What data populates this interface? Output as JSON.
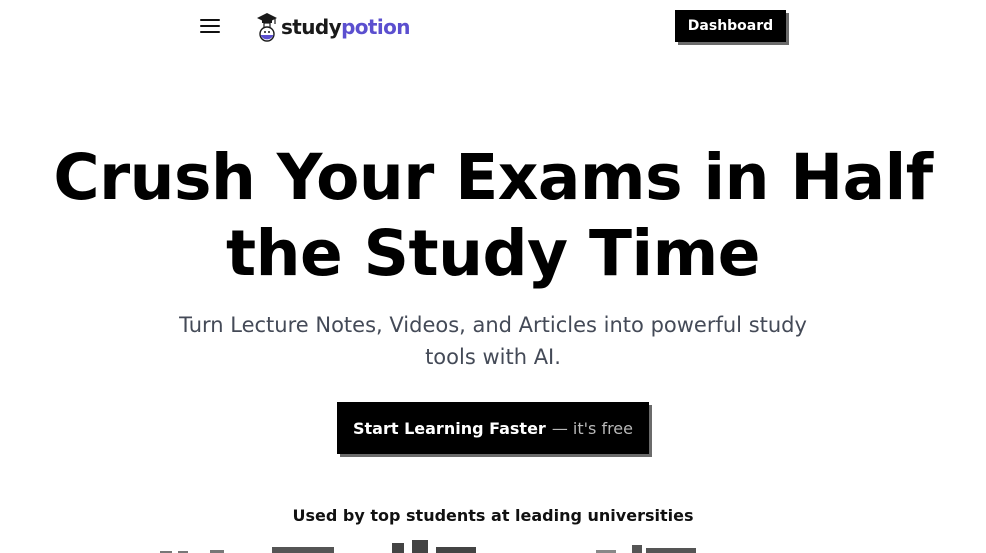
{
  "header": {
    "menu_icon": "hamburger-menu-icon",
    "logo": {
      "icon": "potion-mascot-icon",
      "text_dark": "study",
      "text_accent": "potion",
      "accent_color": "#5b4fcf"
    },
    "dashboard_label": "Dashboard"
  },
  "hero": {
    "title": "Crush Your Exams in Half the Study Time",
    "subtitle": "Turn Lecture Notes, Videos, and Articles into powerful study tools with AI.",
    "cta_main": "Start Learning Faster",
    "cta_suffix": "— it's free"
  },
  "social_proof": {
    "heading": "Used by top students at leading universities"
  }
}
